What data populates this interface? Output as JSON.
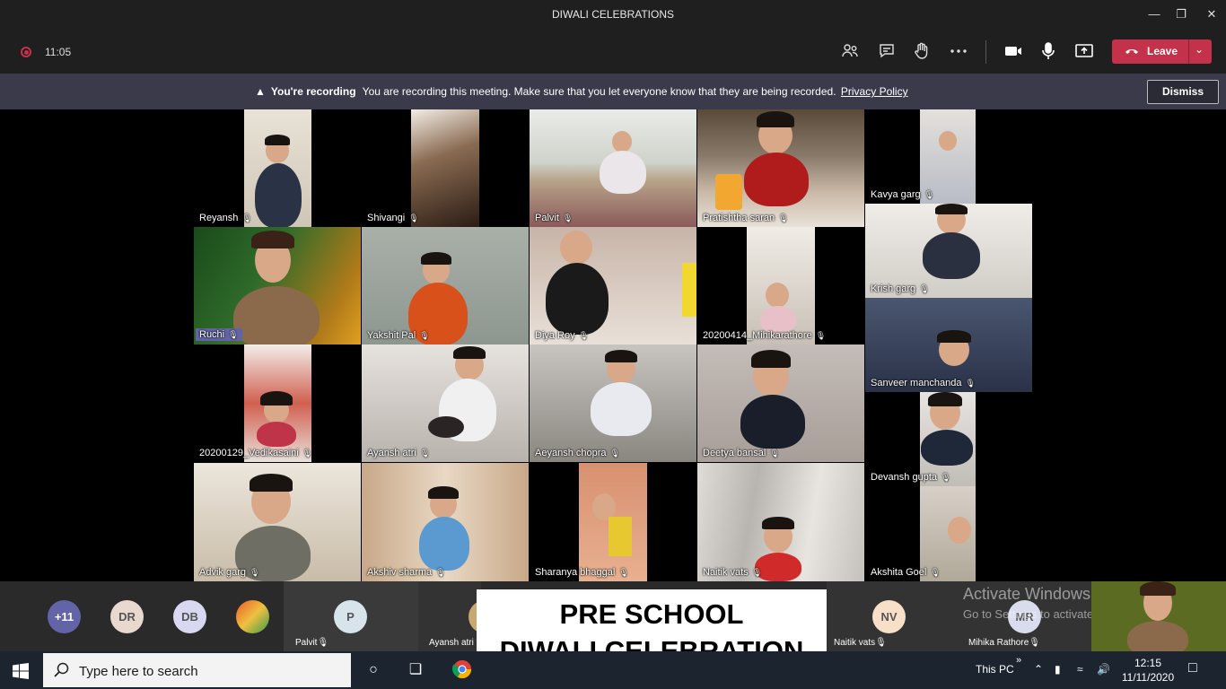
{
  "window": {
    "title": "DIWALI CELEBRATIONS"
  },
  "toolbar": {
    "timer": "11:05",
    "leave_label": "Leave"
  },
  "banner": {
    "bold": "You're recording",
    "text": "You are recording this meeting. Make sure that you let everyone know that they are being recorded.",
    "link": "Privacy Policy",
    "dismiss": "Dismiss"
  },
  "participants": [
    "Reyansh",
    "Shivangi",
    "Palvit",
    "Pratishtha saran",
    "Kavya garg",
    "Ruchi",
    "Yakshit Pal",
    "Diya Roy",
    "20200414_Mihikarathore",
    "Krish garg",
    "Sanveer manchanda",
    "20200129_Vedikasaini",
    "Ayansh atri",
    "Aeyansh chopra",
    "Deetya bansal",
    "Devansh gupta",
    "Advik garg",
    "Akshiv sharma",
    "Sharanya bhaggal",
    "Naitik vats",
    "Akshita Goel"
  ],
  "tray": {
    "overflow": "+11",
    "avatars": [
      "DR",
      "DB",
      "P",
      "NV",
      "MR"
    ],
    "names": [
      "Palvit",
      "Ayansh atri",
      "Naitik vats",
      "Mihika Rathore"
    ]
  },
  "overlay": {
    "line1": "PRE SCHOOL",
    "line2": "DIWALI CELEBRATION"
  },
  "watermark": {
    "line1": "Activate Windows",
    "line2": "Go to Settings to activate Windows."
  },
  "taskbar": {
    "search_placeholder": "Type here to search",
    "this_pc": "This PC",
    "time": "12:15",
    "date": "11/11/2020"
  }
}
